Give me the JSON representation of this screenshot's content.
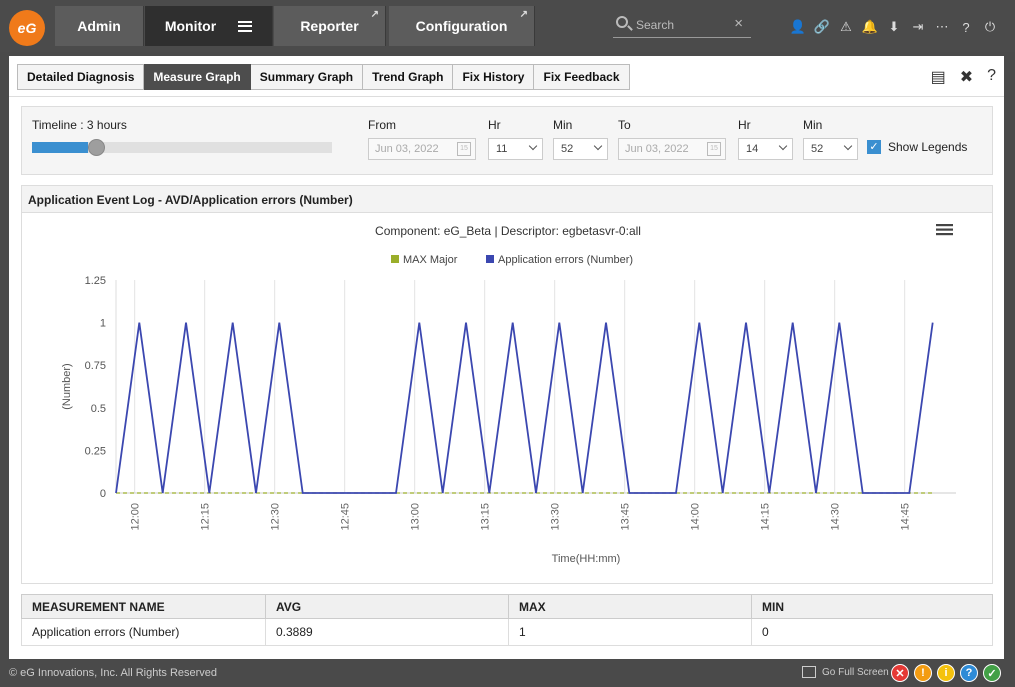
{
  "topnav": {
    "logo": "eG",
    "tabs": [
      {
        "label": "Admin"
      },
      {
        "label": "Monitor"
      },
      {
        "label": "Reporter"
      },
      {
        "label": "Configuration"
      }
    ],
    "search_placeholder": "Search"
  },
  "subtabs": [
    "Detailed Diagnosis",
    "Measure Graph",
    "Summary Graph",
    "Trend Graph",
    "Fix History",
    "Fix Feedback"
  ],
  "filter": {
    "timeline_label": "Timeline : 3 hours",
    "timeline_level": 0.12,
    "from_label": "From",
    "from_date": "Jun 03, 2022",
    "from_hr_label": "Hr",
    "from_hr": "11",
    "from_min_label": "Min",
    "from_min": "52",
    "to_label": "To",
    "to_date": "Jun 03, 2022",
    "to_hr_label": "Hr",
    "to_hr": "14",
    "to_min_label": "Min",
    "to_min": "52",
    "show_legends_label": "Show Legends",
    "show_legends_checked": true
  },
  "chart_panel": {
    "header": "Application Event Log - AVD/Application errors (Number)"
  },
  "chart_data": {
    "type": "line",
    "title": "Component: eG_Beta | Descriptor: egbetasvr-0:all",
    "ylabel": "(Number)",
    "xlabel": "Time(HH:mm)",
    "ylim": [
      0,
      1.25
    ],
    "yticks": [
      0,
      0.25,
      0.5,
      0.75,
      1,
      1.25
    ],
    "xticks": [
      "12:00",
      "12:15",
      "12:30",
      "12:45",
      "13:00",
      "13:15",
      "13:30",
      "13:45",
      "14:00",
      "14:15",
      "14:30",
      "14:45"
    ],
    "legend_position": "top-center",
    "grid": "vertical",
    "series": [
      {
        "name": "MAX Major",
        "color": "#9aae2a",
        "x": [
          "11:56",
          "14:51"
        ],
        "values": [
          0,
          0
        ]
      },
      {
        "name": "Application errors (Number)",
        "color": "#3b47b0",
        "x": [
          "11:56",
          "11:61",
          "12:06",
          "12:11",
          "12:16",
          "12:21",
          "12:26",
          "12:31",
          "12:36",
          "12:41",
          "12:46",
          "12:51",
          "12:56",
          "13:01",
          "13:06",
          "13:11",
          "13:16",
          "13:21",
          "13:26",
          "13:31",
          "13:36",
          "13:41",
          "13:46",
          "13:51",
          "13:56",
          "14:01",
          "14:06",
          "14:11",
          "14:16",
          "14:21",
          "14:26",
          "14:31",
          "14:36",
          "14:41",
          "14:46",
          "14:51"
        ],
        "values": [
          0,
          1,
          0,
          1,
          0,
          1,
          0,
          1,
          0,
          0,
          0,
          0,
          0,
          1,
          0,
          1,
          0,
          1,
          0,
          1,
          0,
          1,
          0,
          0,
          0,
          1,
          0,
          1,
          0,
          1,
          0,
          1,
          0,
          0,
          0,
          1
        ]
      }
    ]
  },
  "measure_table": {
    "headers": [
      "MEASUREMENT NAME",
      "AVG",
      "MAX",
      "MIN"
    ],
    "rows": [
      [
        "Application errors (Number)",
        "0.3889",
        "1",
        "0"
      ]
    ]
  },
  "footer": {
    "copyright": "© eG Innovations, Inc. All Rights Reserved",
    "fullscreen_label": "Go Full Screen"
  },
  "colors": {
    "accent": "#3a8fd0",
    "logo": "#f07a1a",
    "critical": "#e53935",
    "major": "#f39c12",
    "minor": "#f4c20d",
    "info": "#2e8bd6",
    "normal": "#43a047"
  }
}
